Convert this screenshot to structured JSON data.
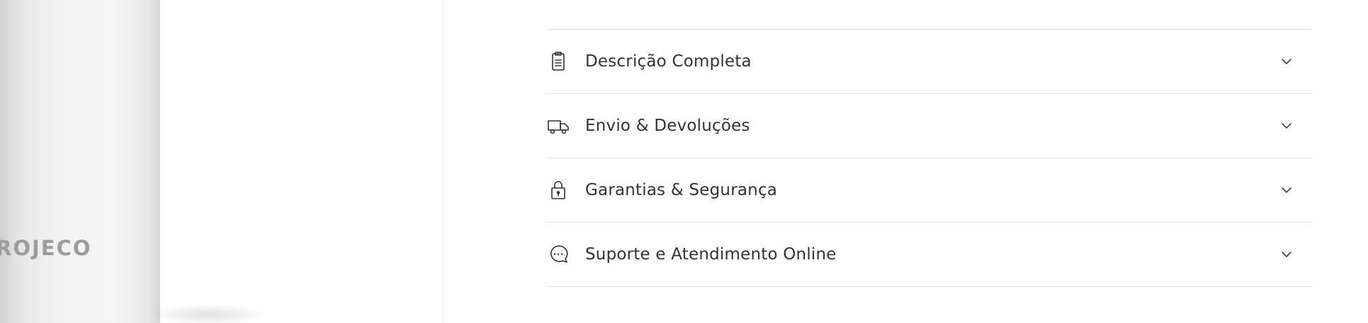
{
  "product_media": {
    "brand_text": "ROJECO"
  },
  "accordion": {
    "items": [
      {
        "label": "Descrição Completa",
        "icon": "clipboard-icon"
      },
      {
        "label": "Envio & Devoluções",
        "icon": "truck-icon"
      },
      {
        "label": "Garantias & Segurança",
        "icon": "lock-icon"
      },
      {
        "label": "Suporte e Atendimento Online",
        "icon": "chat-icon"
      }
    ]
  }
}
